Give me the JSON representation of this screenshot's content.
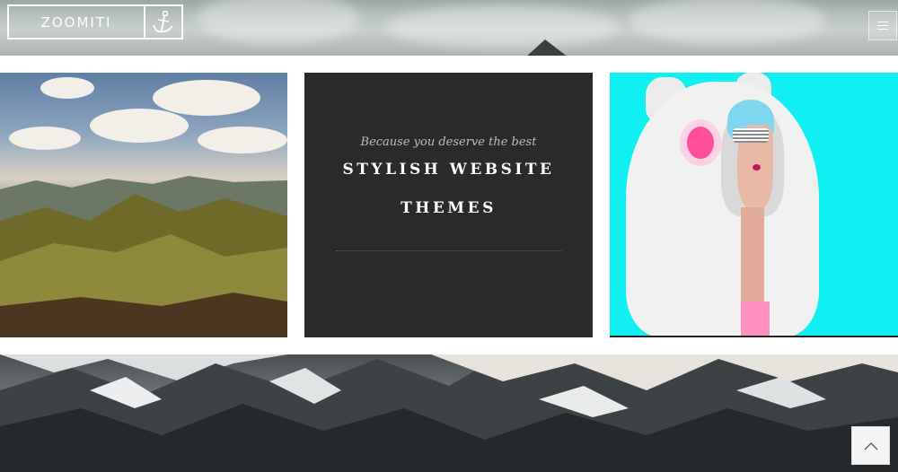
{
  "header": {
    "logo_text": "ZOOMITI",
    "logo_icon": "anchor-icon",
    "menu_icon": "hamburger-menu-icon"
  },
  "tiles": {
    "landscape_image": "mountain-landscape-photo",
    "promo": {
      "subtitle": "Because you deserve the best",
      "title_line1": "STYLISH WEBSITE",
      "title_line2": "THEMES"
    },
    "fashion_image": "fashion-model-photo"
  },
  "banner_image": "snowy-mountains-photo",
  "scroll_top_icon": "chevron-up-icon",
  "colors": {
    "promo_background": "#2a2a2a",
    "fashion_background": "#10f0f2",
    "accent_white": "#ffffff"
  }
}
